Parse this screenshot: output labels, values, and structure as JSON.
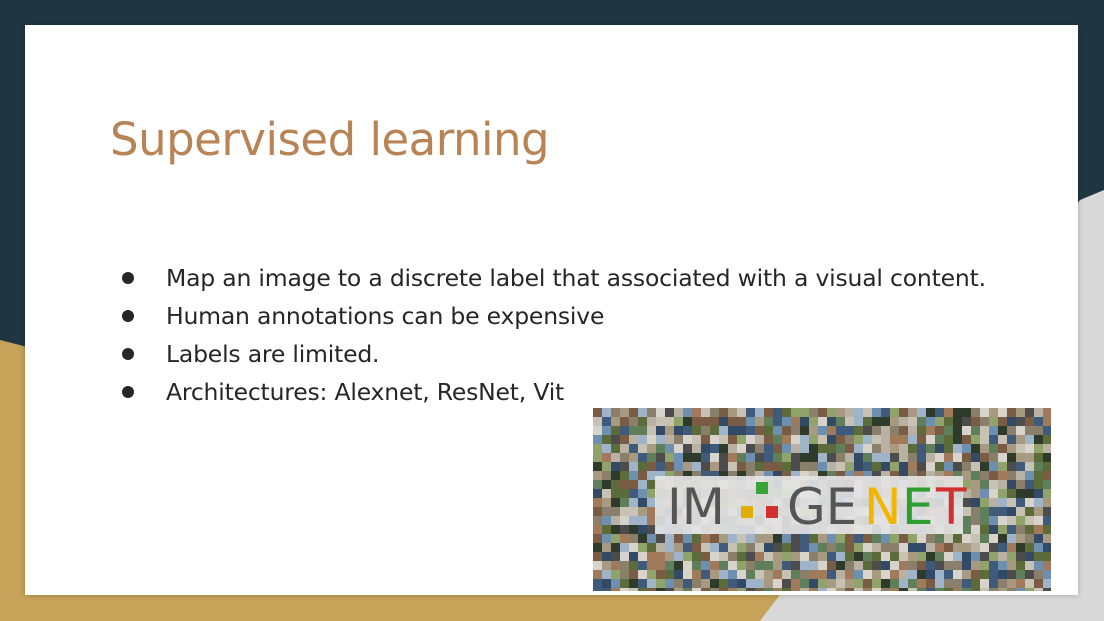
{
  "colors": {
    "background_dark": "#1f3641",
    "accent_gold": "#c7a35a",
    "accent_grey": "#d9d9d9",
    "title": "#b88455",
    "text": "#262626"
  },
  "slide": {
    "title": "Supervised learning",
    "bullets": [
      "Map an image to a discrete label that associated with a visual content.",
      "Human annotations can be expensive",
      "Labels are limited.",
      "Architectures: Alexnet, ResNet, Vit"
    ],
    "image": {
      "logo_text": [
        "IM",
        "GE",
        "N",
        "E",
        "T"
      ],
      "icon": "imagenet-mosaic-image"
    }
  }
}
